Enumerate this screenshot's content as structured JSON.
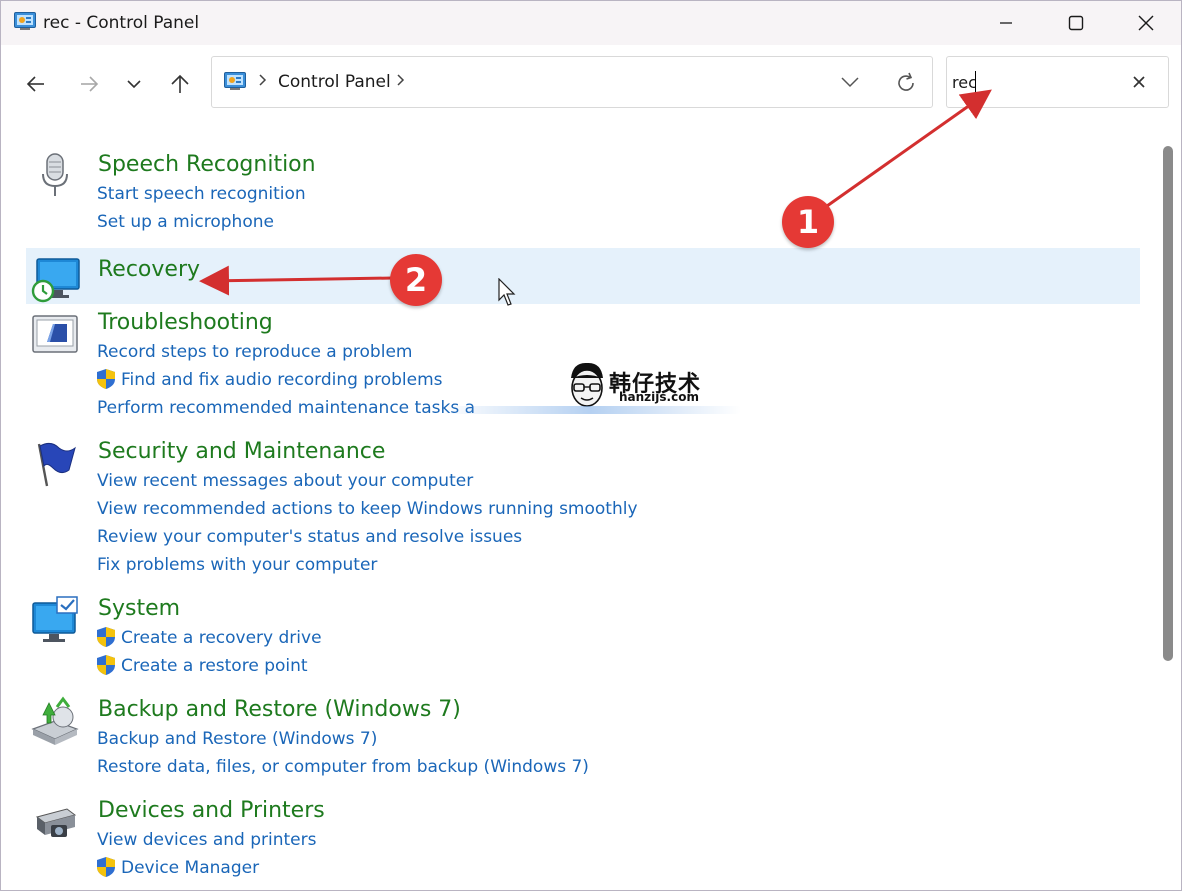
{
  "window": {
    "title": "rec - Control Panel"
  },
  "address": {
    "crumb": "Control Panel"
  },
  "search": {
    "value": "rec"
  },
  "icons": {
    "back": "arrow-left-icon",
    "forward": "arrow-right-icon",
    "recent": "chevron-down-icon",
    "up": "arrow-up-icon",
    "refresh": "refresh-icon",
    "clear": "close-icon"
  },
  "colors": {
    "group_title": "#1e7a1e",
    "task_link": "#1a66b8",
    "highlight": "#e5f1fb",
    "annotation": "#e53935"
  },
  "groups": [
    {
      "title": "Speech Recognition",
      "icon": "microphone-icon",
      "tasks": [
        {
          "label": "Start speech recognition",
          "shield": false
        },
        {
          "label": "Set up a microphone",
          "shield": false
        }
      ]
    },
    {
      "title": "Recovery",
      "icon": "recovery-icon",
      "tasks": []
    },
    {
      "title": "Troubleshooting",
      "icon": "troubleshooting-icon",
      "tasks": [
        {
          "label": "Record steps to reproduce a problem",
          "shield": false
        },
        {
          "label": "Find and fix audio recording problems",
          "shield": true
        },
        {
          "label": "Perform recommended maintenance tasks a",
          "shield": false
        }
      ]
    },
    {
      "title": "Security and Maintenance",
      "icon": "flag-icon",
      "tasks": [
        {
          "label": "View recent messages about your computer",
          "shield": false
        },
        {
          "label": "View recommended actions to keep Windows running smoothly",
          "shield": false
        },
        {
          "label": "Review your computer's status and resolve issues",
          "shield": false
        },
        {
          "label": "Fix problems with your computer",
          "shield": false
        }
      ]
    },
    {
      "title": "System",
      "icon": "system-icon",
      "tasks": [
        {
          "label": "Create a recovery drive",
          "shield": true
        },
        {
          "label": "Create a restore point",
          "shield": true
        }
      ]
    },
    {
      "title": "Backup and Restore (Windows 7)",
      "icon": "backup-icon",
      "tasks": [
        {
          "label": "Backup and Restore (Windows 7)",
          "shield": false
        },
        {
          "label": "Restore data, files, or computer from backup (Windows 7)",
          "shield": false
        }
      ]
    },
    {
      "title": "Devices and Printers",
      "icon": "printer-icon",
      "tasks": [
        {
          "label": "View devices and printers",
          "shield": false
        },
        {
          "label": "Device Manager",
          "shield": true
        }
      ]
    }
  ],
  "annotations": [
    {
      "label": "1"
    },
    {
      "label": "2"
    }
  ],
  "watermark": {
    "cn": "韩仔技术",
    "en": "hanzijs.com"
  }
}
